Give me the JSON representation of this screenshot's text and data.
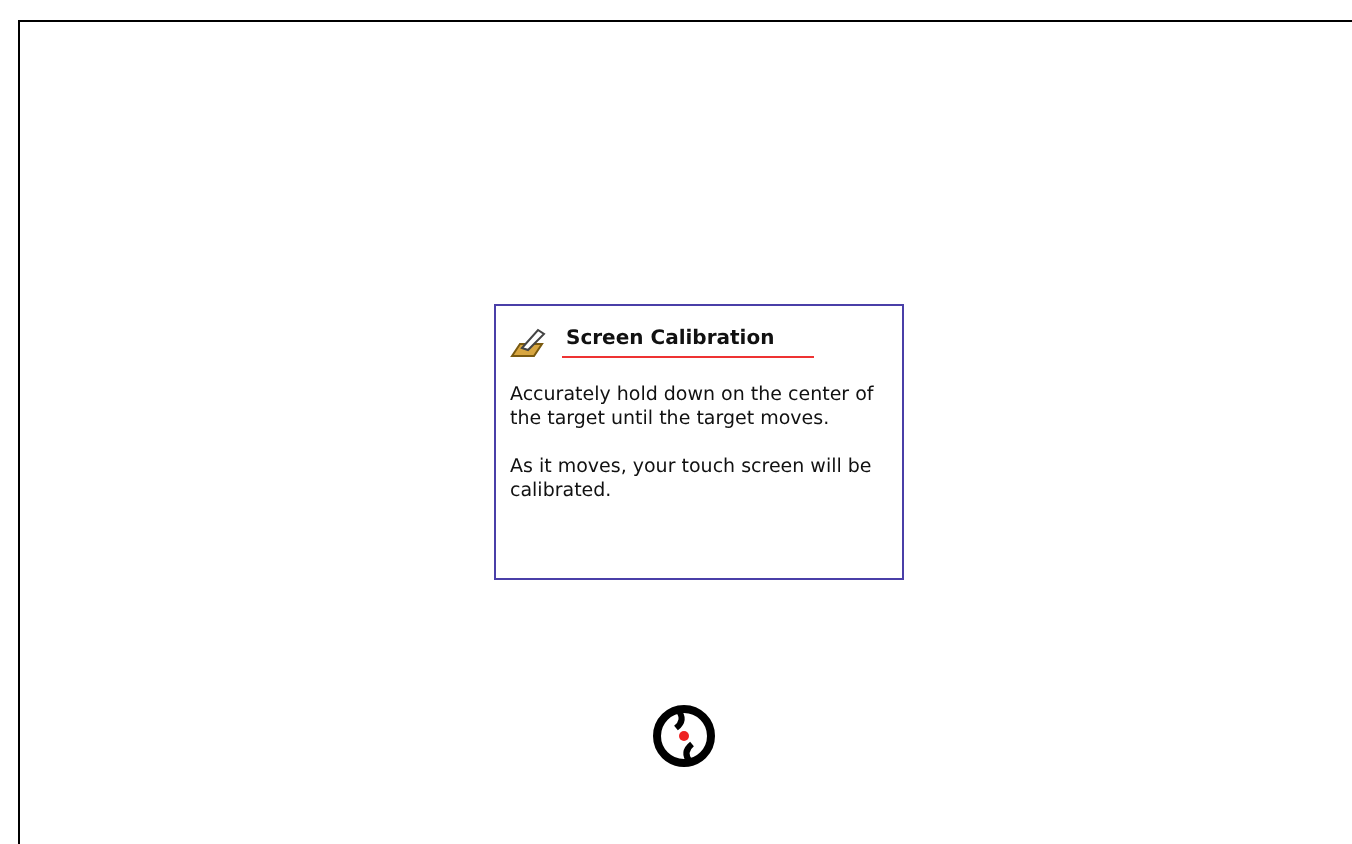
{
  "dialog": {
    "title": "Screen Calibration",
    "paragraphs": [
      "Accurately hold down on the center of the target until the target moves.",
      "As it moves, your touch screen will be calibrated."
    ]
  }
}
